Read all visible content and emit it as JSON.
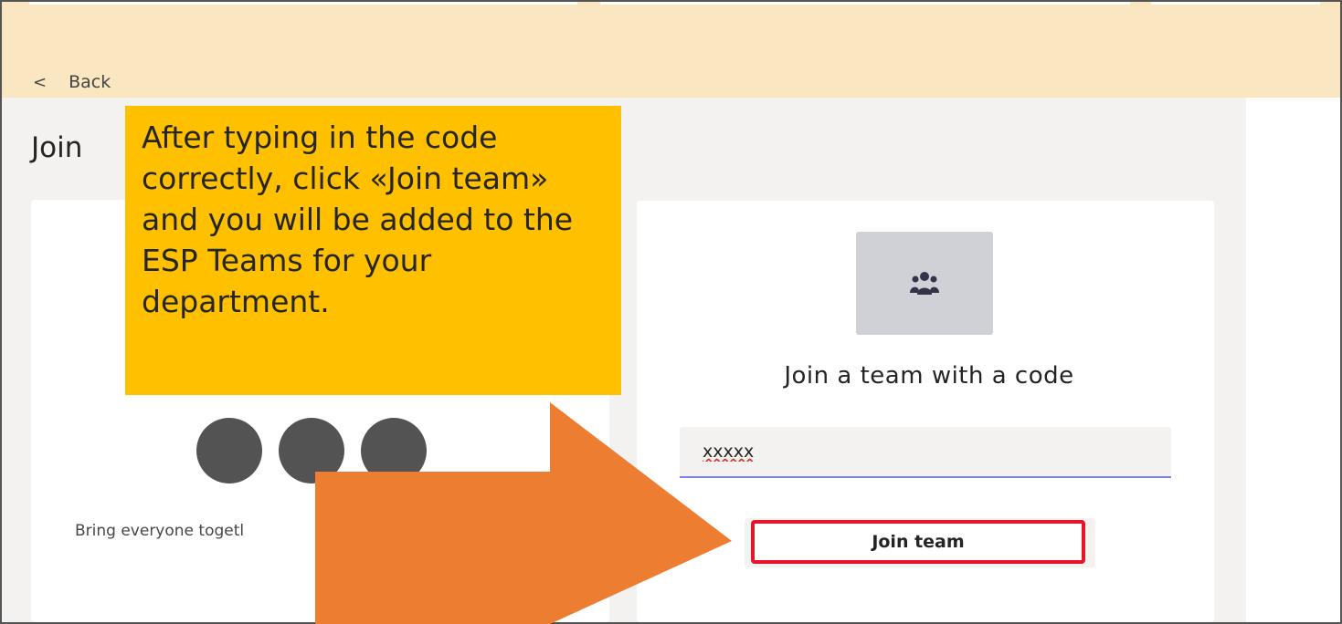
{
  "nav": {
    "back_label": "Back",
    "back_chevron": "<"
  },
  "page": {
    "heading": "Join"
  },
  "left_card": {
    "description": "Bring everyone togetl"
  },
  "right_card": {
    "icon": "people-group-icon",
    "title": "Join a team with a code",
    "code_value": "xxxxx",
    "join_button_label": "Join team"
  },
  "callout": {
    "text": "After typing in the code correctly, click «Join team» and you will be added to the ESP Teams for your department."
  },
  "colors": {
    "callout_bg": "#ffc000",
    "arrow_fill": "#ed7d31",
    "highlight_border": "#e8132a",
    "top_banner": "#fbe6c2",
    "input_underline": "#7b83eb"
  }
}
